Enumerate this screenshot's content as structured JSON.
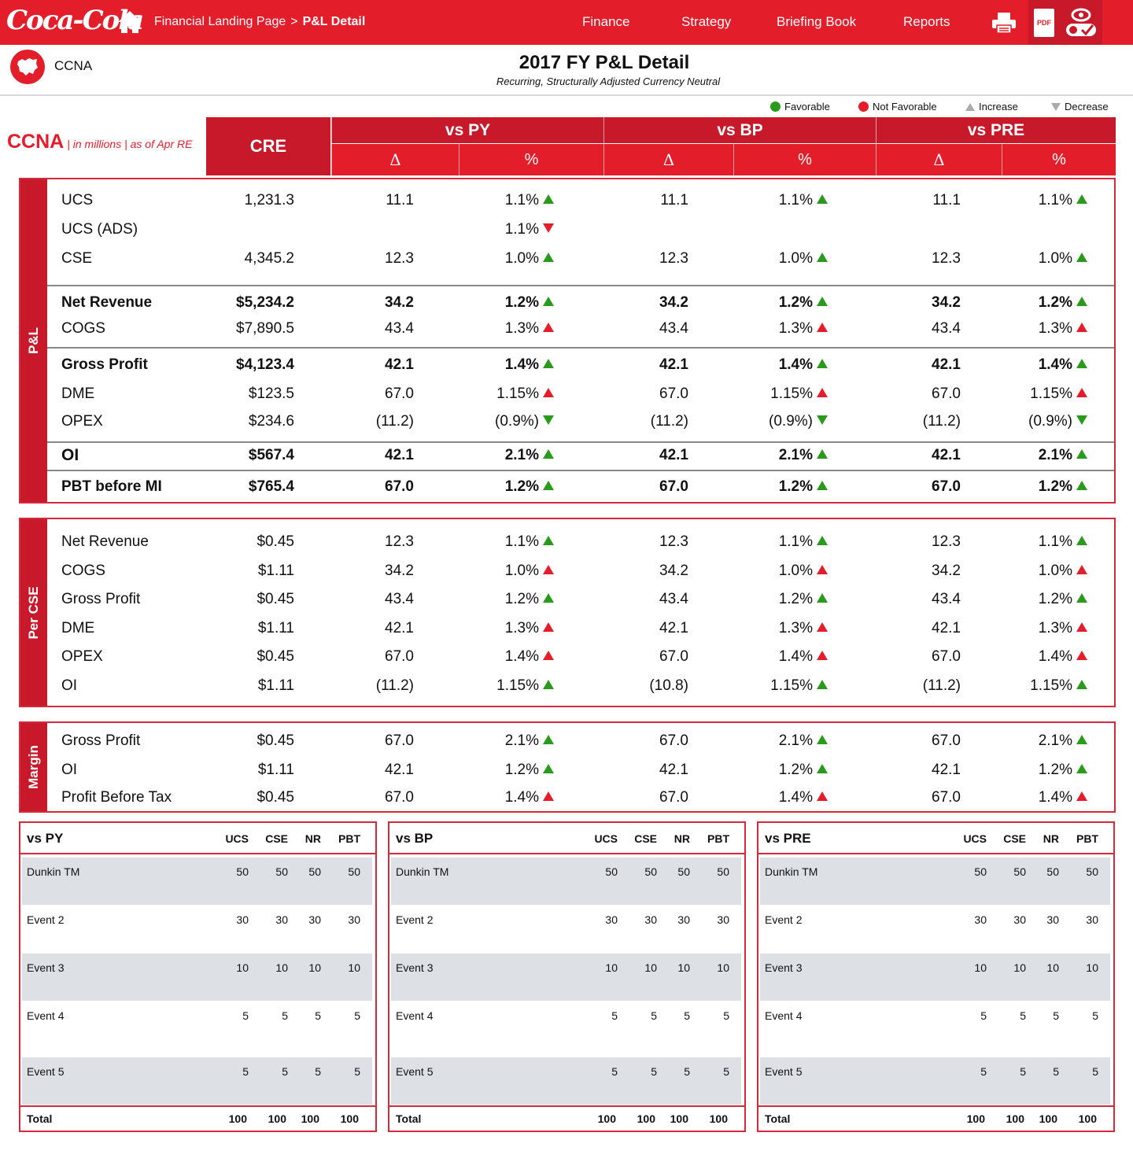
{
  "nav": {
    "logo_text": "Coca-Cola",
    "breadcrumb_root": "Financial Landing Page",
    "breadcrumb_sep": ">",
    "breadcrumb_current": "P&L Detail",
    "links": [
      "Finance",
      "Strategy",
      "Briefing Book",
      "Reports"
    ],
    "pdf_label": "PDF",
    "icons": [
      "home-icon",
      "print-icon",
      "pdf-icon",
      "view-toggle-icon"
    ]
  },
  "header": {
    "region": "CCNA",
    "title": "2017 FY P&L Detail",
    "subtitle": "Recurring, Structurally Adjusted Currency Neutral"
  },
  "legend": {
    "favorable": "Favorable",
    "not_favorable": "Not Favorable",
    "increase": "Increase",
    "decrease": "Decrease"
  },
  "colors": {
    "brand": "#e41d2b",
    "brand_dark": "#c8192a",
    "favorable": "#2a9a1c",
    "not_favorable": "#e41d2b"
  },
  "table_header": {
    "entity": "CCNA",
    "entity_note": "| in millions | as of Apr RE",
    "cre": "CRE",
    "vs_py": "vs PY",
    "vs_bp": "vs BP",
    "vs_pre": "vs PRE",
    "delta": "Δ",
    "pct": "%"
  },
  "sections": {
    "pl": {
      "label": "P&L",
      "rows": [
        {
          "label": "UCS",
          "cre": "1,231.3",
          "py_d": "11.1",
          "py_p": "1.1%",
          "py_a": "up-fav",
          "bp_d": "11.1",
          "bp_p": "1.1%",
          "bp_a": "up-fav",
          "pre_d": "11.1",
          "pre_p": "1.1%",
          "pre_a": "up-fav"
        },
        {
          "label": "UCS (ADS)",
          "cre": "",
          "py_d": "",
          "py_p": "1.1%",
          "py_a": "down-unfav",
          "bp_d": "",
          "bp_p": "",
          "bp_a": "",
          "pre_d": "",
          "pre_p": "",
          "pre_a": ""
        },
        {
          "label": "CSE",
          "cre": "4,345.2",
          "py_d": "12.3",
          "py_p": "1.0%",
          "py_a": "up-fav",
          "bp_d": "12.3",
          "bp_p": "1.0%",
          "bp_a": "up-fav",
          "pre_d": "12.3",
          "pre_p": "1.0%",
          "pre_a": "up-fav"
        },
        {
          "label": "Net Revenue",
          "cre": "$5,234.2",
          "py_d": "34.2",
          "py_p": "1.2%",
          "py_a": "up-fav",
          "bp_d": "34.2",
          "bp_p": "1.2%",
          "bp_a": "up-fav",
          "pre_d": "34.2",
          "pre_p": "1.2%",
          "pre_a": "up-fav"
        },
        {
          "label": "COGS",
          "cre": "$7,890.5",
          "py_d": "43.4",
          "py_p": "1.3%",
          "py_a": "up-unfav",
          "bp_d": "43.4",
          "bp_p": "1.3%",
          "bp_a": "up-unfav",
          "pre_d": "43.4",
          "pre_p": "1.3%",
          "pre_a": "up-unfav"
        },
        {
          "label": "Gross Profit",
          "cre": "$4,123.4",
          "py_d": "42.1",
          "py_p": "1.4%",
          "py_a": "up-fav",
          "bp_d": "42.1",
          "bp_p": "1.4%",
          "bp_a": "up-fav",
          "pre_d": "42.1",
          "pre_p": "1.4%",
          "pre_a": "up-fav"
        },
        {
          "label": "DME",
          "cre": "$123.5",
          "py_d": "67.0",
          "py_p": "1.15%",
          "py_a": "up-unfav",
          "bp_d": "67.0",
          "bp_p": "1.15%",
          "bp_a": "up-unfav",
          "pre_d": "67.0",
          "pre_p": "1.15%",
          "pre_a": "up-unfav"
        },
        {
          "label": "OPEX",
          "cre": "$234.6",
          "py_d": "(11.2)",
          "py_p": "(0.9%)",
          "py_a": "down-fav",
          "bp_d": "(11.2)",
          "bp_p": "(0.9%)",
          "bp_a": "down-fav",
          "pre_d": "(11.2)",
          "pre_p": "(0.9%)",
          "pre_a": "down-fav"
        },
        {
          "label": "OI",
          "cre": "$567.4",
          "py_d": "42.1",
          "py_p": "2.1%",
          "py_a": "up-fav",
          "bp_d": "42.1",
          "bp_p": "2.1%",
          "bp_a": "up-fav",
          "pre_d": "42.1",
          "pre_p": "2.1%",
          "pre_a": "up-fav"
        },
        {
          "label": "PBT before MI",
          "cre": "$765.4",
          "py_d": "67.0",
          "py_p": "1.2%",
          "py_a": "up-fav",
          "bp_d": "67.0",
          "bp_p": "1.2%",
          "bp_a": "up-fav",
          "pre_d": "67.0",
          "pre_p": "1.2%",
          "pre_a": "up-fav"
        }
      ]
    },
    "per_cse": {
      "label": "Per CSE",
      "rows": [
        {
          "label": "Net Revenue",
          "cre": "$0.45",
          "py_d": "12.3",
          "py_p": "1.1%",
          "py_a": "up-fav",
          "bp_d": "12.3",
          "bp_p": "1.1%",
          "bp_a": "up-fav",
          "pre_d": "12.3",
          "pre_p": "1.1%",
          "pre_a": "up-fav"
        },
        {
          "label": "COGS",
          "cre": "$1.11",
          "py_d": "34.2",
          "py_p": "1.0%",
          "py_a": "up-unfav",
          "bp_d": "34.2",
          "bp_p": "1.0%",
          "bp_a": "up-unfav",
          "pre_d": "34.2",
          "pre_p": "1.0%",
          "pre_a": "up-unfav"
        },
        {
          "label": "Gross Profit",
          "cre": "$0.45",
          "py_d": "43.4",
          "py_p": "1.2%",
          "py_a": "up-fav",
          "bp_d": "43.4",
          "bp_p": "1.2%",
          "bp_a": "up-fav",
          "pre_d": "43.4",
          "pre_p": "1.2%",
          "pre_a": "up-fav"
        },
        {
          "label": "DME",
          "cre": "$1.11",
          "py_d": "42.1",
          "py_p": "1.3%",
          "py_a": "up-unfav",
          "bp_d": "42.1",
          "bp_p": "1.3%",
          "bp_a": "up-unfav",
          "pre_d": "42.1",
          "pre_p": "1.3%",
          "pre_a": "up-unfav"
        },
        {
          "label": "OPEX",
          "cre": "$0.45",
          "py_d": "67.0",
          "py_p": "1.4%",
          "py_a": "up-unfav",
          "bp_d": "67.0",
          "bp_p": "1.4%",
          "bp_a": "up-unfav",
          "pre_d": "67.0",
          "pre_p": "1.4%",
          "pre_a": "up-unfav"
        },
        {
          "label": "OI",
          "cre": "$1.11",
          "py_d": "(11.2)",
          "py_p": "1.15%",
          "py_a": "up-fav",
          "bp_d": "(10.8)",
          "bp_p": "1.15%",
          "bp_a": "up-fav",
          "pre_d": "(11.2)",
          "pre_p": "1.15%",
          "pre_a": "up-fav"
        }
      ]
    },
    "margin": {
      "label": "Margin",
      "rows": [
        {
          "label": "Gross Profit",
          "cre": "$0.45",
          "py_d": "67.0",
          "py_p": "2.1%",
          "py_a": "up-fav",
          "bp_d": "67.0",
          "bp_p": "2.1%",
          "bp_a": "up-fav",
          "pre_d": "67.0",
          "pre_p": "2.1%",
          "pre_a": "up-fav"
        },
        {
          "label": "OI",
          "cre": "$1.11",
          "py_d": "42.1",
          "py_p": "1.2%",
          "py_a": "up-fav",
          "bp_d": "42.1",
          "bp_p": "1.2%",
          "bp_a": "up-fav",
          "pre_d": "42.1",
          "pre_p": "1.2%",
          "pre_a": "up-fav"
        },
        {
          "label": "Profit Before Tax",
          "cre": "$0.45",
          "py_d": "67.0",
          "py_p": "1.4%",
          "py_a": "up-unfav",
          "bp_d": "67.0",
          "bp_p": "1.4%",
          "bp_a": "up-unfav",
          "pre_d": "67.0",
          "pre_p": "1.4%",
          "pre_a": "up-unfav"
        }
      ]
    }
  },
  "events": {
    "columns": [
      "UCS",
      "CSE",
      "NR",
      "PBT"
    ],
    "tables": [
      {
        "title": "vs PY"
      },
      {
        "title": "vs BP"
      },
      {
        "title": "vs PRE"
      }
    ],
    "rows": [
      {
        "name": "Dunkin TM",
        "values": [
          "50",
          "50",
          "50",
          "50"
        ]
      },
      {
        "name": "Event 2",
        "values": [
          "30",
          "30",
          "30",
          "30"
        ]
      },
      {
        "name": "Event 3",
        "values": [
          "10",
          "10",
          "10",
          "10"
        ]
      },
      {
        "name": "Event 4",
        "values": [
          "5",
          "5",
          "5",
          "5"
        ]
      },
      {
        "name": "Event 5",
        "values": [
          "5",
          "5",
          "5",
          "5"
        ]
      }
    ],
    "total": {
      "name": "Total",
      "values": [
        "100",
        "100",
        "100",
        "100"
      ]
    }
  }
}
